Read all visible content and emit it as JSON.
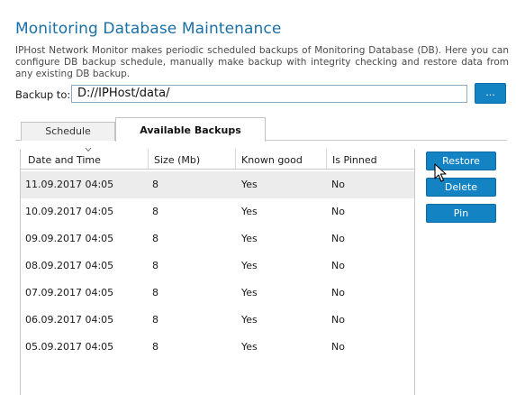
{
  "header": {
    "title": "Monitoring Database Maintenance",
    "description": "IPHost Network Monitor makes periodic scheduled backups of Monitoring Database (DB). Here you can configure DB backup schedule, manually make backup with integrity checking and restore data from any existing DB backup."
  },
  "backup_path": {
    "label": "Backup to:",
    "value": "D://IPHost/data/",
    "browse_label": "..."
  },
  "tabs": [
    {
      "label": "Schedule",
      "active": false
    },
    {
      "label": "Available Backups",
      "active": true
    }
  ],
  "table": {
    "columns": [
      "Date and Time",
      "Size (Mb)",
      "Known good",
      "Is Pinned"
    ],
    "sort_column": "Date and Time",
    "sort_icon": "sort-desc-icon",
    "rows": [
      {
        "date": "11.09.2017 04:05",
        "size": "8",
        "known_good": "Yes",
        "pinned": "No"
      },
      {
        "date": "10.09.2017 04:05",
        "size": "8",
        "known_good": "Yes",
        "pinned": "No"
      },
      {
        "date": "09.09.2017 04:05",
        "size": "8",
        "known_good": "Yes",
        "pinned": "No"
      },
      {
        "date": "08.09.2017 04:05",
        "size": "8",
        "known_good": "Yes",
        "pinned": "No"
      },
      {
        "date": "07.09.2017 04:05",
        "size": "8",
        "known_good": "Yes",
        "pinned": "No"
      },
      {
        "date": "06.09.2017 04:05",
        "size": "8",
        "known_good": "Yes",
        "pinned": "No"
      },
      {
        "date": "05.09.2017 04:05",
        "size": "8",
        "known_good": "Yes",
        "pinned": "No"
      }
    ],
    "selected_row": 0
  },
  "actions": {
    "restore": "Restore",
    "delete": "Delete",
    "pin": "Pin"
  },
  "colors": {
    "accent": "#1483c4",
    "title": "#1a6fa5",
    "selected_row": "#ececec"
  }
}
